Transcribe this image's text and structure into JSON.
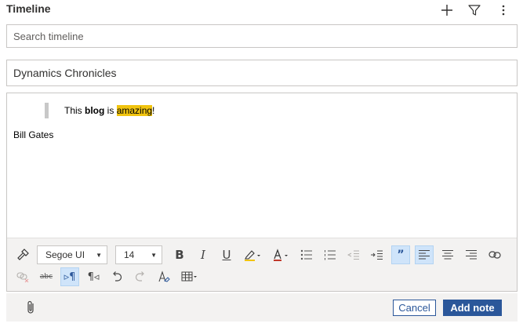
{
  "header": {
    "title": "Timeline",
    "actions": [
      {
        "icon": "add-icon"
      },
      {
        "icon": "filter-icon"
      },
      {
        "icon": "more-icon"
      }
    ]
  },
  "search": {
    "placeholder": "Search timeline",
    "value": ""
  },
  "note": {
    "subject": "Dynamics Chronicles",
    "body": {
      "quote_parts": [
        "This ",
        "blog",
        " is ",
        "amazing",
        "!"
      ],
      "highlight_color": "#f1c40f",
      "signature": "Bill Gates"
    }
  },
  "toolbar": {
    "font_family": "Segoe UI",
    "font_size": "14",
    "row1": [
      "format-painter-icon",
      "bold-icon",
      "italic-icon",
      "underline-icon",
      "highlight-icon",
      "font-color-icon",
      "bullet-list-icon",
      "numbered-list-icon",
      "decrease-indent-icon",
      "increase-indent-icon",
      "blockquote-icon",
      "align-left-icon",
      "align-center-icon",
      "align-right-icon",
      "link-icon"
    ],
    "row2": [
      "unlink-icon",
      "strikethrough-icon",
      "ltr-icon",
      "rtl-icon",
      "undo-icon",
      "redo-icon",
      "clear-format-icon",
      "table-icon"
    ],
    "active": [
      "blockquote-icon",
      "align-left-icon",
      "ltr-icon"
    ],
    "accent_color": "#cfe4fa"
  },
  "footer": {
    "cancel_label": "Cancel",
    "add_label": "Add note",
    "primary_color": "#2b579a"
  }
}
